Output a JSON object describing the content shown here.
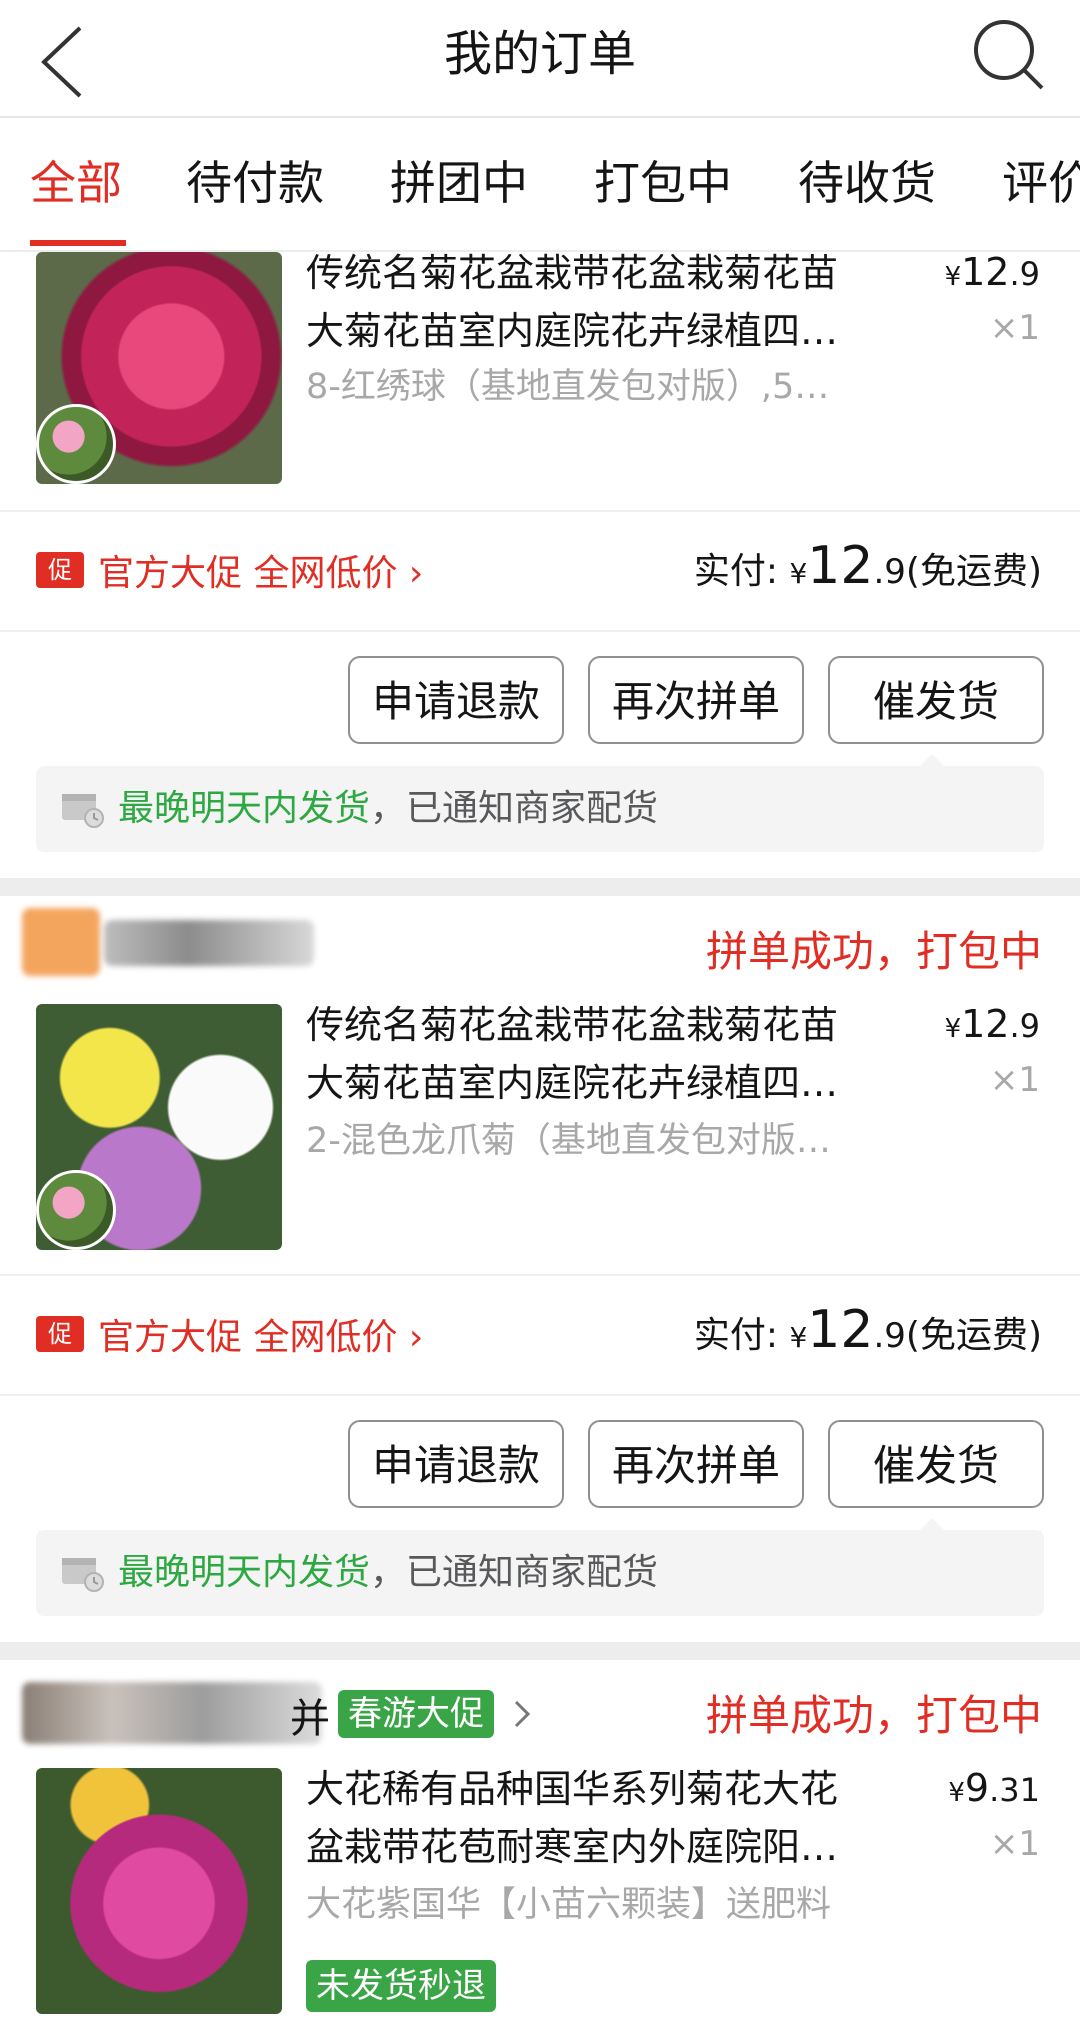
{
  "header": {
    "title": "我的订单",
    "back_icon": "chevron-left-icon",
    "search_icon": "search-icon"
  },
  "tabs": [
    {
      "label": "全部",
      "active": true
    },
    {
      "label": "待付款"
    },
    {
      "label": "拼团中"
    },
    {
      "label": "打包中"
    },
    {
      "label": "待收货"
    },
    {
      "label": "评价"
    }
  ],
  "orders": [
    {
      "status": "",
      "product": {
        "name_line1": "传统名菊花盆栽带花盆栽菊花苗",
        "name_line2": "大菊花苗室内庭院花卉绿植四…",
        "spec": "8-红绣球（基地直发包对版）,5…",
        "price_yen": "¥",
        "price_int": "12",
        "price_dec": ".9",
        "qty": "×1"
      },
      "promo_icon": "促",
      "promo": "官方大促 全网低价 ›",
      "paid_label": "实付:",
      "paid_yen": "¥",
      "paid_int": "12",
      "paid_dec": ".9",
      "paid_note": "(免运费)",
      "buttons": [
        "申请退款",
        "再次拼单",
        "催发货"
      ],
      "notice_green": "最晚明天内发货",
      "notice_rest": "，已通知商家配货"
    },
    {
      "status": "拼单成功，打包中",
      "product": {
        "name_line1": "传统名菊花盆栽带花盆栽菊花苗",
        "name_line2": "大菊花苗室内庭院花卉绿植四…",
        "spec": "2-混色龙爪菊（基地直发包对版…",
        "price_yen": "¥",
        "price_int": "12",
        "price_dec": ".9",
        "qty": "×1"
      },
      "promo_icon": "促",
      "promo": "官方大促 全网低价 ›",
      "paid_label": "实付:",
      "paid_yen": "¥",
      "paid_int": "12",
      "paid_dec": ".9",
      "paid_note": "(免运费)",
      "buttons": [
        "申请退款",
        "再次拼单",
        "催发货"
      ],
      "notice_green": "最晚明天内发货",
      "notice_rest": "，已通知商家配货"
    },
    {
      "status": "拼单成功，打包中",
      "shop_tag": "春游大促",
      "shop_tag_prefix": "并",
      "product": {
        "name_line1": "大花稀有品种国华系列菊花大花",
        "name_line2": "盆栽带花苞耐寒室内外庭院阳…",
        "spec": "大花紫国华【小苗六颗装】送肥料",
        "price_yen": "¥",
        "price_int": "9",
        "price_dec": ".31",
        "qty": "×1",
        "tag": "未发货秒退"
      }
    }
  ]
}
